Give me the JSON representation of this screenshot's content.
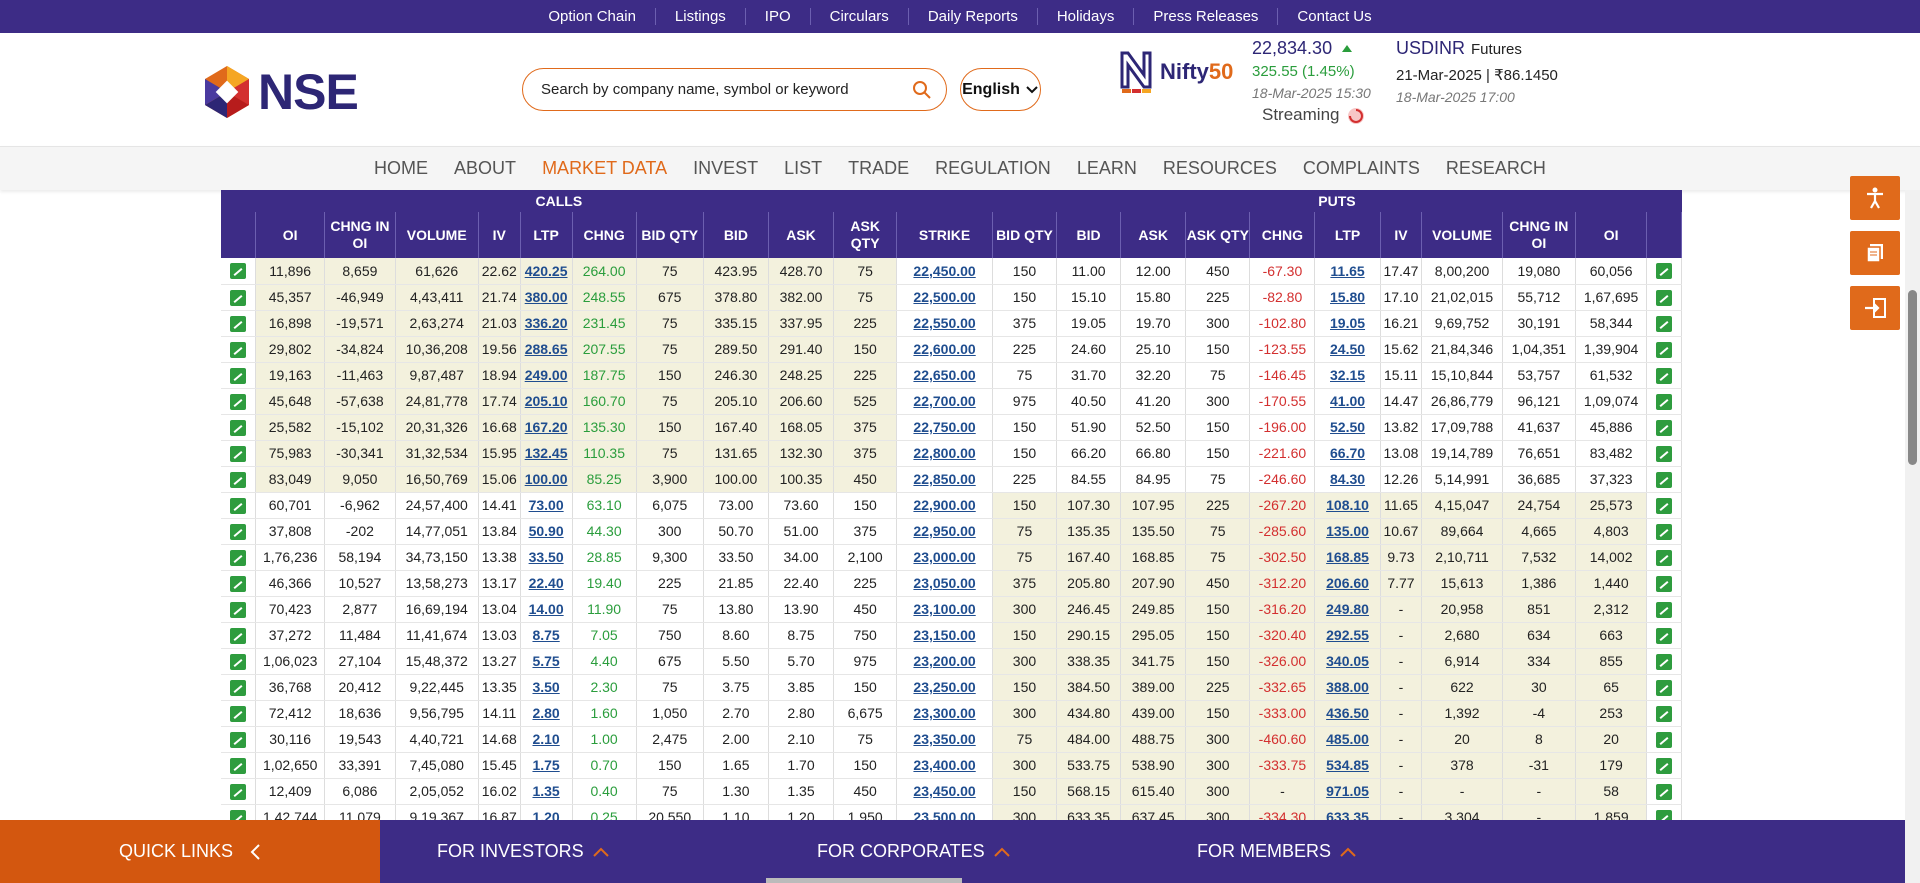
{
  "topbar": {
    "links": [
      "Option Chain",
      "Listings",
      "IPO",
      "Circulars",
      "Daily Reports",
      "Holidays",
      "Press Releases",
      "Contact Us"
    ]
  },
  "header": {
    "logo_text": "NSE",
    "search_placeholder": "Search by company name, symbol or keyword",
    "language": "English",
    "nifty_label_a": "Nifty",
    "nifty_label_b": "50",
    "index_value": "22,834.30",
    "index_change": "325.55 (1.45%)",
    "index_time": "18-Mar-2025 15:30",
    "streaming": "Streaming",
    "usd_symbol": "USDINR",
    "usd_type": "Futures",
    "usd_price": "21-Mar-2025 | ₹86.1450",
    "usd_time": "18-Mar-2025 17:00"
  },
  "nav": [
    "HOME",
    "ABOUT",
    "MARKET DATA",
    "INVEST",
    "LIST",
    "TRADE",
    "REGULATION",
    "LEARN",
    "RESOURCES",
    "COMPLAINTS",
    "RESEARCH"
  ],
  "table": {
    "group_calls": "CALLS",
    "group_puts": "PUTS",
    "columns": [
      "OI",
      "CHNG IN OI",
      "VOLUME",
      "IV",
      "LTP",
      "CHNG",
      "BID QTY",
      "BID",
      "ASK",
      "ASK QTY",
      "STRIKE",
      "BID QTY",
      "BID",
      "ASK",
      "ASK QTY",
      "CHNG",
      "LTP",
      "IV",
      "VOLUME",
      "CHNG IN OI",
      "OI"
    ],
    "rows": [
      [
        "11,896",
        "8,659",
        "61,626",
        "22.62",
        "420.25",
        "264.00",
        "75",
        "423.95",
        "428.70",
        "75",
        "22,450.00",
        "150",
        "11.00",
        "12.00",
        "450",
        "-67.30",
        "11.65",
        "17.47",
        "8,00,200",
        "19,080",
        "60,056"
      ],
      [
        "45,357",
        "-46,949",
        "4,43,411",
        "21.74",
        "380.00",
        "248.55",
        "675",
        "378.80",
        "382.00",
        "75",
        "22,500.00",
        "150",
        "15.10",
        "15.80",
        "225",
        "-82.80",
        "15.80",
        "17.10",
        "21,02,015",
        "55,712",
        "1,67,695"
      ],
      [
        "16,898",
        "-19,571",
        "2,63,274",
        "21.03",
        "336.20",
        "231.45",
        "75",
        "335.15",
        "337.95",
        "225",
        "22,550.00",
        "375",
        "19.05",
        "19.70",
        "300",
        "-102.80",
        "19.05",
        "16.21",
        "9,69,752",
        "30,191",
        "58,344"
      ],
      [
        "29,802",
        "-34,824",
        "10,36,208",
        "19.56",
        "288.65",
        "207.55",
        "75",
        "289.50",
        "291.40",
        "150",
        "22,600.00",
        "225",
        "24.60",
        "25.10",
        "150",
        "-123.55",
        "24.50",
        "15.62",
        "21,84,346",
        "1,04,351",
        "1,39,904"
      ],
      [
        "19,163",
        "-11,463",
        "9,87,487",
        "18.94",
        "249.00",
        "187.75",
        "150",
        "246.30",
        "248.25",
        "225",
        "22,650.00",
        "75",
        "31.70",
        "32.20",
        "75",
        "-146.45",
        "32.15",
        "15.11",
        "15,10,844",
        "53,757",
        "61,532"
      ],
      [
        "45,648",
        "-57,638",
        "24,81,778",
        "17.74",
        "205.10",
        "160.70",
        "75",
        "205.10",
        "206.60",
        "525",
        "22,700.00",
        "975",
        "40.50",
        "41.20",
        "300",
        "-170.55",
        "41.00",
        "14.47",
        "26,86,779",
        "96,121",
        "1,09,074"
      ],
      [
        "25,582",
        "-15,102",
        "20,31,326",
        "16.68",
        "167.20",
        "135.30",
        "150",
        "167.40",
        "168.05",
        "375",
        "22,750.00",
        "150",
        "51.90",
        "52.50",
        "150",
        "-196.00",
        "52.50",
        "13.82",
        "17,09,788",
        "41,637",
        "45,886"
      ],
      [
        "75,983",
        "-30,341",
        "31,32,534",
        "15.95",
        "132.45",
        "110.35",
        "75",
        "131.65",
        "132.30",
        "375",
        "22,800.00",
        "150",
        "66.20",
        "66.80",
        "150",
        "-221.60",
        "66.70",
        "13.08",
        "19,14,789",
        "76,651",
        "83,482"
      ],
      [
        "83,049",
        "9,050",
        "16,50,769",
        "15.06",
        "100.00",
        "85.25",
        "3,900",
        "100.00",
        "100.35",
        "450",
        "22,850.00",
        "225",
        "84.55",
        "84.95",
        "75",
        "-246.60",
        "84.30",
        "12.26",
        "5,14,991",
        "36,685",
        "37,323"
      ],
      [
        "60,701",
        "-6,962",
        "24,57,400",
        "14.41",
        "73.00",
        "63.10",
        "6,075",
        "73.00",
        "73.60",
        "150",
        "22,900.00",
        "150",
        "107.30",
        "107.95",
        "225",
        "-267.20",
        "108.10",
        "11.65",
        "4,15,047",
        "24,754",
        "25,573"
      ],
      [
        "37,808",
        "-202",
        "14,77,051",
        "13.84",
        "50.90",
        "44.30",
        "300",
        "50.70",
        "51.00",
        "375",
        "22,950.00",
        "75",
        "135.35",
        "135.50",
        "75",
        "-285.60",
        "135.00",
        "10.67",
        "89,664",
        "4,665",
        "4,803"
      ],
      [
        "1,76,236",
        "58,194",
        "34,73,150",
        "13.38",
        "33.50",
        "28.85",
        "9,300",
        "33.50",
        "34.00",
        "2,100",
        "23,000.00",
        "75",
        "167.40",
        "168.85",
        "75",
        "-302.50",
        "168.85",
        "9.73",
        "2,10,711",
        "7,532",
        "14,002"
      ],
      [
        "46,366",
        "10,527",
        "13,58,273",
        "13.17",
        "22.40",
        "19.40",
        "225",
        "21.85",
        "22.40",
        "225",
        "23,050.00",
        "375",
        "205.80",
        "207.90",
        "450",
        "-312.20",
        "206.60",
        "7.77",
        "15,613",
        "1,386",
        "1,440"
      ],
      [
        "70,423",
        "2,877",
        "16,69,194",
        "13.04",
        "14.00",
        "11.90",
        "75",
        "13.80",
        "13.90",
        "450",
        "23,100.00",
        "300",
        "246.45",
        "249.85",
        "150",
        "-316.20",
        "249.80",
        "-",
        "20,958",
        "851",
        "2,312"
      ],
      [
        "37,272",
        "11,484",
        "11,41,674",
        "13.03",
        "8.75",
        "7.05",
        "750",
        "8.60",
        "8.75",
        "750",
        "23,150.00",
        "150",
        "290.15",
        "295.05",
        "150",
        "-320.40",
        "292.55",
        "-",
        "2,680",
        "634",
        "663"
      ],
      [
        "1,06,023",
        "27,104",
        "15,48,372",
        "13.27",
        "5.75",
        "4.40",
        "675",
        "5.50",
        "5.70",
        "975",
        "23,200.00",
        "300",
        "338.35",
        "341.75",
        "150",
        "-326.00",
        "340.05",
        "-",
        "6,914",
        "334",
        "855"
      ],
      [
        "36,768",
        "20,412",
        "9,22,445",
        "13.35",
        "3.50",
        "2.30",
        "75",
        "3.75",
        "3.85",
        "150",
        "23,250.00",
        "150",
        "384.50",
        "389.00",
        "225",
        "-332.65",
        "388.00",
        "-",
        "622",
        "30",
        "65"
      ],
      [
        "72,412",
        "18,636",
        "9,56,795",
        "14.11",
        "2.80",
        "1.60",
        "1,050",
        "2.70",
        "2.80",
        "6,675",
        "23,300.00",
        "300",
        "434.80",
        "439.00",
        "150",
        "-333.00",
        "436.50",
        "-",
        "1,392",
        "-4",
        "253"
      ],
      [
        "30,116",
        "19,543",
        "4,40,721",
        "14.68",
        "2.10",
        "1.00",
        "2,475",
        "2.00",
        "2.10",
        "75",
        "23,350.00",
        "75",
        "484.00",
        "488.75",
        "300",
        "-460.60",
        "485.00",
        "-",
        "20",
        "8",
        "20"
      ],
      [
        "1,02,650",
        "33,391",
        "7,45,080",
        "15.45",
        "1.75",
        "0.70",
        "150",
        "1.65",
        "1.70",
        "150",
        "23,400.00",
        "300",
        "533.75",
        "538.90",
        "300",
        "-333.75",
        "534.85",
        "-",
        "378",
        "-31",
        "179"
      ],
      [
        "12,409",
        "6,086",
        "2,05,052",
        "16.02",
        "1.35",
        "0.40",
        "75",
        "1.30",
        "1.35",
        "450",
        "23,450.00",
        "150",
        "568.15",
        "615.40",
        "300",
        "-",
        "971.05",
        "-",
        "-",
        "-",
        "58"
      ],
      [
        "1,42,744",
        "11,079",
        "9,19,367",
        "16.87",
        "1.20",
        "0.25",
        "20,550",
        "1.10",
        "1.20",
        "1,950",
        "23,500.00",
        "300",
        "633.35",
        "637.45",
        "300",
        "-334.30",
        "633.35",
        "-",
        "3,304",
        "-",
        "1,859"
      ]
    ]
  },
  "footer": {
    "quick_links": "QUICK LINKS",
    "investors": "FOR INVESTORS",
    "corporates": "FOR CORPORATES",
    "members": "FOR MEMBERS"
  },
  "colors": {
    "brand_purple": "#3d2c86",
    "brand_orange": "#e06a1b",
    "positive": "#2a9d3c",
    "negative": "#d32f2f",
    "itm_bg": "#f3f1dd"
  }
}
